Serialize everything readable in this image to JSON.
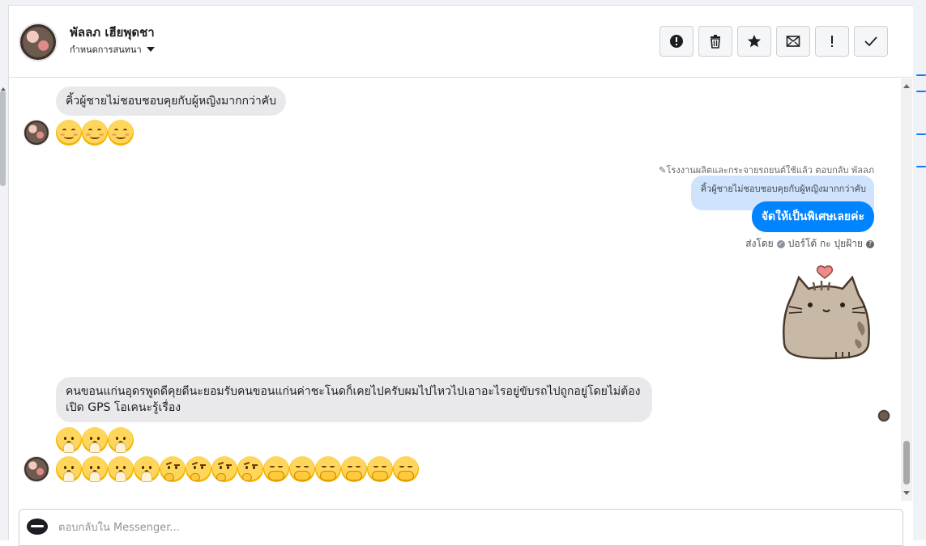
{
  "header": {
    "contact_name": "พัลลภ เฮียพุดชา",
    "conversation_settings": "กำหนดการสนทนา",
    "actions": [
      {
        "name": "report-button",
        "icon": "alert-circle-icon"
      },
      {
        "name": "delete-button",
        "icon": "trash-icon"
      },
      {
        "name": "star-button",
        "icon": "star-icon"
      },
      {
        "name": "mark-unread-button",
        "icon": "envelope-icon"
      },
      {
        "name": "important-button",
        "icon": "exclamation-icon"
      },
      {
        "name": "done-button",
        "icon": "check-icon"
      }
    ]
  },
  "messages": {
    "msg1_text": "คิ้วผู้ชายไม่ชอบชอบคุยกับผู้หญิงมากกว่าคับ",
    "reply_meta": "โรงงานผลิตและกระจายรถยนต์ใช้แล้ว ตอบกลับ พัลลภ",
    "reply_quote": "คิ้วผู้ชายไม่ชอบชอบคุยกับผู้หญิงมากกว่าคับ",
    "out_text": "จัดให้เป็นพิเศษเลยค่ะ",
    "sent_by_label": "ส่งโดย",
    "sent_by_name": "ปอร์โต้ กะ ปุยฝ้าย",
    "msg2_text": "คนขอนแก่นอุดรพูดดีคุยดีนะยอมรับคนขอนแก่นค่าชะโนดก็เคยไปครับผมไปไหวไปเอาอะไรอยู่ขับรถไปถูกอยู่โดยไม่ต้องเปิด GPS โอเคนะรู้เรื่อง",
    "emoji_row1": [
      "smiling-face",
      "smiling-face",
      "smiling-face"
    ],
    "emoji_row2": [
      "face-with-hand-over-mouth",
      "face-with-hand-over-mouth",
      "face-with-hand-over-mouth"
    ],
    "emoji_row3": [
      "face-with-hand-over-mouth",
      "face-with-hand-over-mouth",
      "face-with-hand-over-mouth",
      "face-with-hand-over-mouth",
      "thinking-face",
      "thinking-face",
      "thinking-face",
      "thinking-face",
      "hugging-face",
      "hugging-face",
      "hugging-face",
      "hugging-face",
      "hugging-face",
      "hugging-face"
    ],
    "sticker": "pusheen-cat-heart-sticker"
  },
  "composer": {
    "placeholder": "ตอบกลับใน Messenger..."
  },
  "colors": {
    "outgoing_bubble": "#0084ff",
    "incoming_bubble": "#e9e9eb",
    "quote_bubble": "#cfe3fd"
  }
}
